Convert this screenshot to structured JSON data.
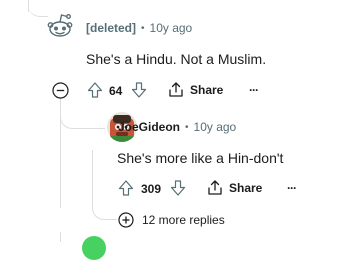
{
  "parent_comment": {
    "author": "[deleted]",
    "separator": "•",
    "age": "10y ago",
    "text": "She's a Hindu. Not a Muslim.",
    "votes": "64",
    "share_label": "Share",
    "more_label": "···"
  },
  "reply_comment": {
    "author": "JoeGideon",
    "separator": "•",
    "age": "10y ago",
    "text": "She's more like a Hin-don't",
    "votes": "309",
    "share_label": "Share",
    "more_label": "···"
  },
  "more_replies": {
    "label": "12 more replies"
  },
  "colors": {
    "thread_line": "#dcdfe2",
    "meta_text": "#576f76",
    "body_text": "#1c1c1c",
    "avatar_bg": "#c8553a",
    "next_avatar": "#46d160"
  },
  "icons": [
    "snoo-avatar-icon",
    "collapse-minus-icon",
    "upvote-icon",
    "downvote-icon",
    "share-icon",
    "more-options-icon",
    "joegideon-avatar-icon",
    "expand-plus-icon"
  ]
}
